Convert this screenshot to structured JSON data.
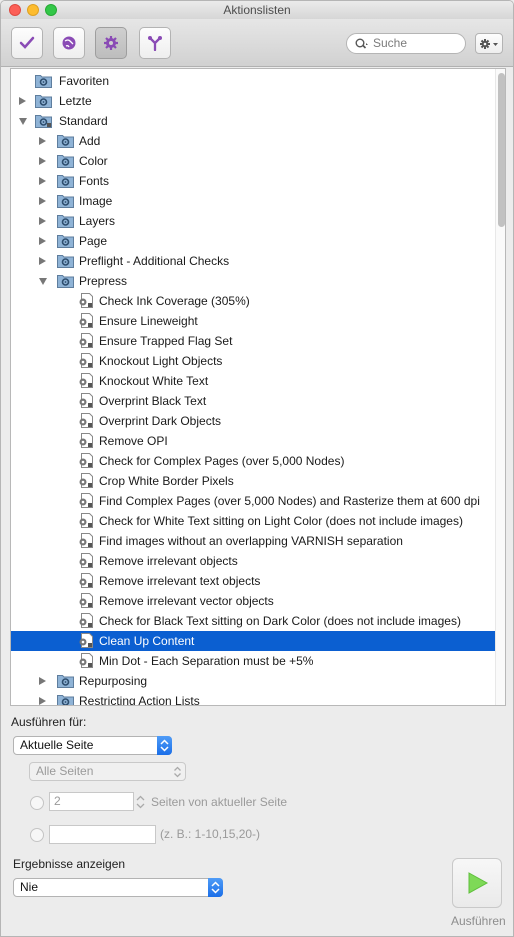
{
  "window": {
    "title": "Aktionslisten"
  },
  "toolbar": {
    "buttons": [
      {
        "name": "check-button",
        "icon": "checkmark-icon"
      },
      {
        "name": "globe-button",
        "icon": "globe-icon"
      },
      {
        "name": "settings-button",
        "icon": "gear-icon",
        "active": true
      },
      {
        "name": "filter-button",
        "icon": "fork-icon"
      }
    ],
    "search_placeholder": "Suche",
    "accent": "#8a4bb5"
  },
  "tree": [
    {
      "label": "Favoriten",
      "level": 0,
      "expand": "none",
      "icon": "folder-green"
    },
    {
      "label": "Letzte",
      "level": 0,
      "expand": "closed",
      "icon": "folder-green"
    },
    {
      "label": "Standard",
      "level": 0,
      "expand": "open",
      "icon": "folder-green-lock"
    },
    {
      "label": "Add",
      "level": 1,
      "expand": "closed",
      "icon": "folder-blue"
    },
    {
      "label": "Color",
      "level": 1,
      "expand": "closed",
      "icon": "folder-blue"
    },
    {
      "label": "Fonts",
      "level": 1,
      "expand": "closed",
      "icon": "folder-blue"
    },
    {
      "label": "Image",
      "level": 1,
      "expand": "closed",
      "icon": "folder-blue"
    },
    {
      "label": "Layers",
      "level": 1,
      "expand": "closed",
      "icon": "folder-blue"
    },
    {
      "label": "Page",
      "level": 1,
      "expand": "closed",
      "icon": "folder-blue"
    },
    {
      "label": "Preflight - Additional Checks",
      "level": 1,
      "expand": "closed",
      "icon": "folder-blue"
    },
    {
      "label": "Prepress",
      "level": 1,
      "expand": "open",
      "icon": "folder-blue"
    },
    {
      "label": "Check Ink Coverage (305%)",
      "level": 2,
      "expand": "none",
      "icon": "action"
    },
    {
      "label": "Ensure Lineweight",
      "level": 2,
      "expand": "none",
      "icon": "action"
    },
    {
      "label": "Ensure Trapped Flag Set",
      "level": 2,
      "expand": "none",
      "icon": "action"
    },
    {
      "label": "Knockout Light Objects",
      "level": 2,
      "expand": "none",
      "icon": "action"
    },
    {
      "label": "Knockout White Text",
      "level": 2,
      "expand": "none",
      "icon": "action"
    },
    {
      "label": "Overprint Black Text",
      "level": 2,
      "expand": "none",
      "icon": "action"
    },
    {
      "label": "Overprint Dark Objects",
      "level": 2,
      "expand": "none",
      "icon": "action"
    },
    {
      "label": "Remove OPI",
      "level": 2,
      "expand": "none",
      "icon": "action"
    },
    {
      "label": "Check for Complex Pages (over 5,000 Nodes)",
      "level": 2,
      "expand": "none",
      "icon": "action"
    },
    {
      "label": "Crop White Border Pixels",
      "level": 2,
      "expand": "none",
      "icon": "action"
    },
    {
      "label": "Find Complex Pages (over 5,000 Nodes) and Rasterize them at 600 dpi",
      "level": 2,
      "expand": "none",
      "icon": "action"
    },
    {
      "label": "Check for White Text sitting on Light Color (does not include images)",
      "level": 2,
      "expand": "none",
      "icon": "action"
    },
    {
      "label": "Find images without an overlapping VARNISH separation",
      "level": 2,
      "expand": "none",
      "icon": "action"
    },
    {
      "label": "Remove irrelevant objects",
      "level": 2,
      "expand": "none",
      "icon": "action"
    },
    {
      "label": "Remove irrelevant text objects",
      "level": 2,
      "expand": "none",
      "icon": "action"
    },
    {
      "label": "Remove irrelevant vector objects",
      "level": 2,
      "expand": "none",
      "icon": "action"
    },
    {
      "label": "Check for Black Text sitting on Dark Color (does not include images)",
      "level": 2,
      "expand": "none",
      "icon": "action"
    },
    {
      "label": "Clean Up Content",
      "level": 2,
      "expand": "none",
      "icon": "action",
      "selected": true
    },
    {
      "label": "Min Dot - Each Separation must be +5%",
      "level": 2,
      "expand": "none",
      "icon": "action"
    },
    {
      "label": "Repurposing",
      "level": 1,
      "expand": "closed",
      "icon": "folder-blue"
    },
    {
      "label": "Restricting Action Lists",
      "level": 1,
      "expand": "closed",
      "icon": "folder-blue"
    }
  ],
  "run_for": {
    "label": "Ausführen für:",
    "selected": "Aktuelle Seite",
    "pages_select": "Alle Seiten",
    "pages_count_value": "2",
    "pages_count_suffix": "Seiten von aktueller Seite",
    "range_hint": "(z. B.: 1-10,15,20-)"
  },
  "results": {
    "label": "Ergebnisse anzeigen",
    "selected": "Nie"
  },
  "run_button": {
    "label": "Ausführen",
    "color": "#7ed957"
  },
  "selection_color": "#0b5fd1"
}
